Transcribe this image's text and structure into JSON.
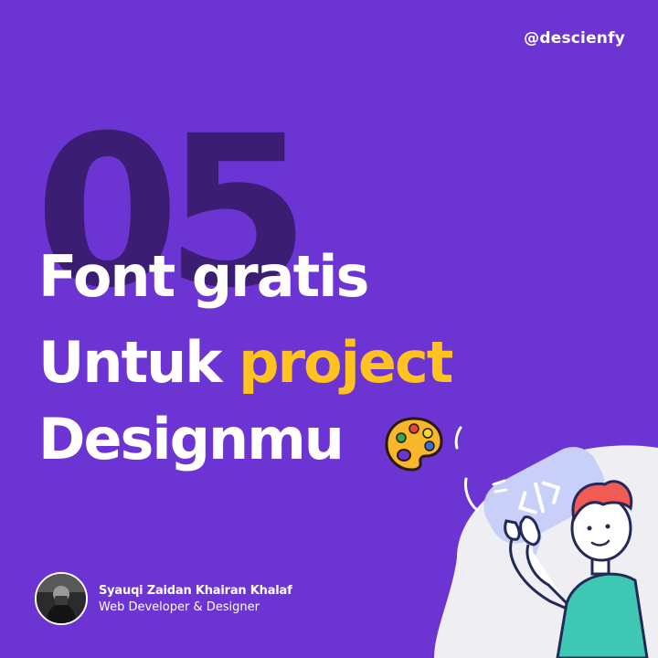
{
  "handle": "@descienfy",
  "number": "05",
  "headline": {
    "line1": "Font gratis",
    "line2_plain": "Untuk",
    "line2_accent": "project",
    "line3": "Designmu"
  },
  "profile": {
    "name": "Syauqi Zaidan Khairan Khalaf",
    "role": "Web Developer & Designer"
  },
  "colors": {
    "background": "#6c34d2",
    "number": "#3b1d73",
    "accent": "#ffc21e",
    "text": "#ffffff"
  },
  "icons": [
    "palette-icon",
    "developer-illustration",
    "avatar"
  ]
}
